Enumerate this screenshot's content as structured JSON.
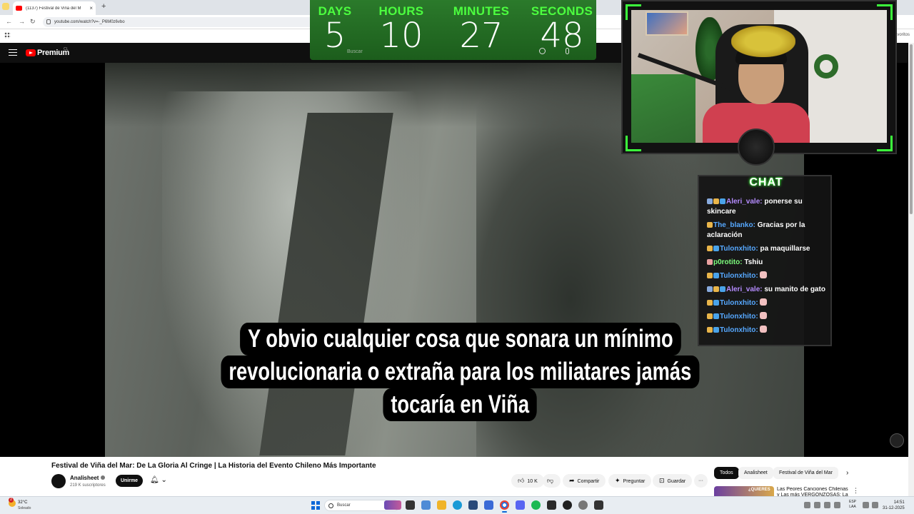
{
  "browser": {
    "tab_title": "(1137) Festival de Viña del M",
    "tab_close": "×",
    "new_tab": "+",
    "url": "youtube.com/watch?v=-_P6M0z6vbo",
    "favorites_label": "avoritos"
  },
  "youtube": {
    "logo_text": "Premium",
    "region": "CL",
    "search_placeholder": "Buscar"
  },
  "countdown": {
    "units": [
      {
        "label": "DAYS",
        "value": "5"
      },
      {
        "label": "HOURS",
        "value": "10"
      },
      {
        "label": "MINUTES",
        "value": "27"
      },
      {
        "label": "SECONDS",
        "value": "48"
      }
    ]
  },
  "subtitle": {
    "lines": [
      "Y obvio cualquier cosa que sonara un mínimo",
      "revolucionaria o extraña para los miliatares jamás",
      "tocaría en Viña"
    ]
  },
  "chat": {
    "title": "CHAT",
    "messages": [
      {
        "user": "Aleri_vale:",
        "text": "ponerse su skincare"
      },
      {
        "user": "The_blanko:",
        "text": "Gracias por la aclaración"
      },
      {
        "user": "Tulonxhito:",
        "text": "pa maquillarse"
      },
      {
        "user": "p0rotito:",
        "text": "Tshiu"
      },
      {
        "user": "Tulonxhito:",
        "text": ""
      },
      {
        "user": "Aleri_vale:",
        "text": "su manito de gato"
      },
      {
        "user": "Tulonxhito:",
        "text": ""
      },
      {
        "user": "Tulonxhito:",
        "text": ""
      },
      {
        "user": "Tulonxhito:",
        "text": ""
      }
    ]
  },
  "video_info": {
    "title": "Festival de Viña del Mar: De La Gloria Al Cringe | La Historia del Evento Chileno Más Importante",
    "channel": "Analisheet",
    "subscribers": "219 K suscriptores",
    "join_label": "Unirme",
    "likes": "10 K",
    "share_label": "Compartir",
    "ask_label": "Preguntar",
    "save_label": "Guardar",
    "more": "···"
  },
  "chips": [
    "Todos",
    "Analisheet",
    "Festival de Viña del Mar"
  ],
  "recommended": {
    "thumb_text": "¿QUIERES",
    "title": "Las Peores Canciones Chilenas y Las más VERGONZOSAS: La"
  },
  "taskbar": {
    "temp": "32°C",
    "weather": "Soleado",
    "weather_badge": "2",
    "search_placeholder": "Buscar",
    "lang_top": "ESP",
    "lang_bottom": "LAA",
    "time": "14:51",
    "date": "31-12-2025"
  }
}
